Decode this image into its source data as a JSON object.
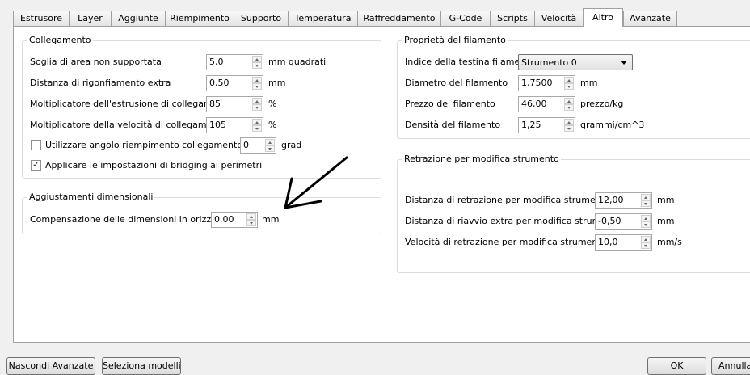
{
  "tabs": [
    {
      "label": "Estrusore"
    },
    {
      "label": "Layer"
    },
    {
      "label": "Aggiunte"
    },
    {
      "label": "Riempimento"
    },
    {
      "label": "Supporto"
    },
    {
      "label": "Temperatura"
    },
    {
      "label": "Raffreddamento"
    },
    {
      "label": "G-Code"
    },
    {
      "label": "Scripts"
    },
    {
      "label": "Velocità"
    },
    {
      "label": "Altro",
      "active": true
    },
    {
      "label": "Avanzate"
    }
  ],
  "collegamento": {
    "title": "Collegamento",
    "fields": [
      {
        "label": "Soglia di area non supportata",
        "value": "5,0",
        "unit": "mm quadrati"
      },
      {
        "label": "Distanza di rigonfiamento extra",
        "value": "0,50",
        "unit": "mm"
      },
      {
        "label": "Moltiplicatore dell'estrusione di collegamento",
        "value": "85",
        "unit": "%"
      },
      {
        "label": "Moltiplicatore della velocità di collegamento",
        "value": "105",
        "unit": "%"
      }
    ],
    "fixed_angle": {
      "label": "Utilizzare angolo riempimento collegamento fissa",
      "checked": false,
      "value": "0",
      "unit": "grad"
    },
    "apply_perimeters": {
      "label": "Applicare le impostazioni di bridging ai perimetri",
      "checked": true
    }
  },
  "aggiustamenti": {
    "title": "Aggiustamenti dimensionali",
    "fields": [
      {
        "label": "Compensazione delle dimensioni in orizzontale",
        "value": "0,00",
        "unit": "mm"
      }
    ]
  },
  "filamento": {
    "title": "Proprietà del filamento",
    "head_label": "Indice della testina filamenti",
    "head_value": "Strumento 0",
    "fields": [
      {
        "label": "Diametro del filamento",
        "value": "1,7500",
        "unit": "mm"
      },
      {
        "label": "Prezzo del filamento",
        "value": "46,00",
        "unit": "prezzo/kg"
      },
      {
        "label": "Densità del filamento",
        "value": "1,25",
        "unit": "grammi/cm^3"
      }
    ]
  },
  "retrazione": {
    "title": "Retrazione per modifica strumento",
    "fields": [
      {
        "label": "Distanza di retrazione per modifica strumento",
        "value": "12,00",
        "unit": "mm"
      },
      {
        "label": "Distanza di riavvio extra per modifica strumento",
        "value": "-0,50",
        "unit": "mm"
      },
      {
        "label": "Velocità di retrazione per modifica strumento",
        "value": "10,0",
        "unit": "mm/s"
      }
    ]
  },
  "buttons": {
    "hide_advanced": "Nascondi Avanzate",
    "select_models": "Seleziona modelli",
    "ok": "OK",
    "cancel": "Annulla"
  }
}
